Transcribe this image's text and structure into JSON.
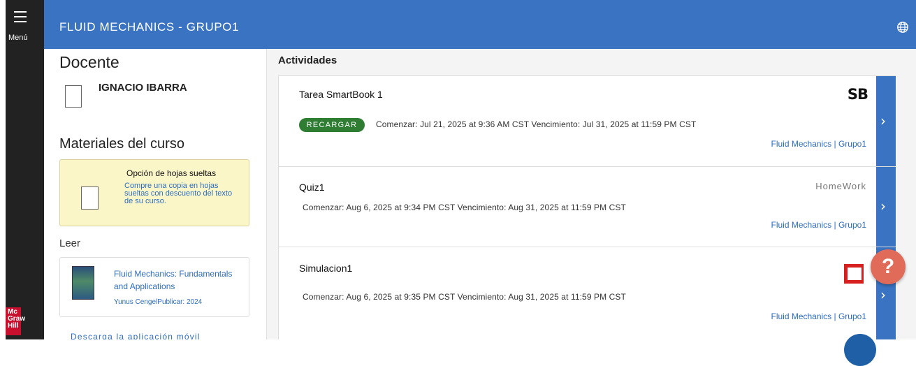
{
  "nav": {
    "menu_label": "Menú",
    "logo_text": "Mc Graw Hill"
  },
  "header": {
    "course_title": "FLUID MECHANICS - GRUPO1"
  },
  "left": {
    "docente_heading": "Docente",
    "teacher_name": "IGNACIO IBARRA",
    "materiales_heading": "Materiales del curso",
    "loose_leaf": {
      "title": "Opción de hojas sueltas",
      "description": "Compre una copia en hojas sueltas con descuento del texto de su curso."
    },
    "leer_label": "Leer",
    "book": {
      "title": "Fluid Mechanics: Fundamentals and Applications",
      "meta": "Yunus CengelPublicar: 2024"
    },
    "download_label": "Descarga la aplicación móvil"
  },
  "activities": {
    "heading": "Actividades",
    "items": [
      {
        "title": "Tarea SmartBook 1",
        "type_label": "SB",
        "badge": "RECARGAR",
        "dates": "Comenzar: Jul 21, 2025 at 9:36 AM CST  Vencimiento: Jul 31, 2025 at 11:59 PM CST",
        "course": "Fluid Mechanics | Grupo1"
      },
      {
        "title": "Quiz1",
        "type_label": "HomeWork",
        "dates": "Comenzar: Aug 6, 2025 at 9:34 PM CST  Vencimiento: Aug 31, 2025 at 11:59 PM CST",
        "course": "Fluid Mechanics | Grupo1"
      },
      {
        "title": "Simulacion1",
        "dates": "Comenzar: Aug 6, 2025 at 9:35 PM CST  Vencimiento: Aug 31, 2025 at 11:59 PM CST",
        "course": "Fluid Mechanics | Grupo1"
      }
    ]
  },
  "help": {
    "label": "?"
  },
  "colors": {
    "primary": "#3a73c2",
    "rail": "#222222",
    "badge": "#2e7d32",
    "help": "#e06b58",
    "link": "#2d6dbf"
  }
}
